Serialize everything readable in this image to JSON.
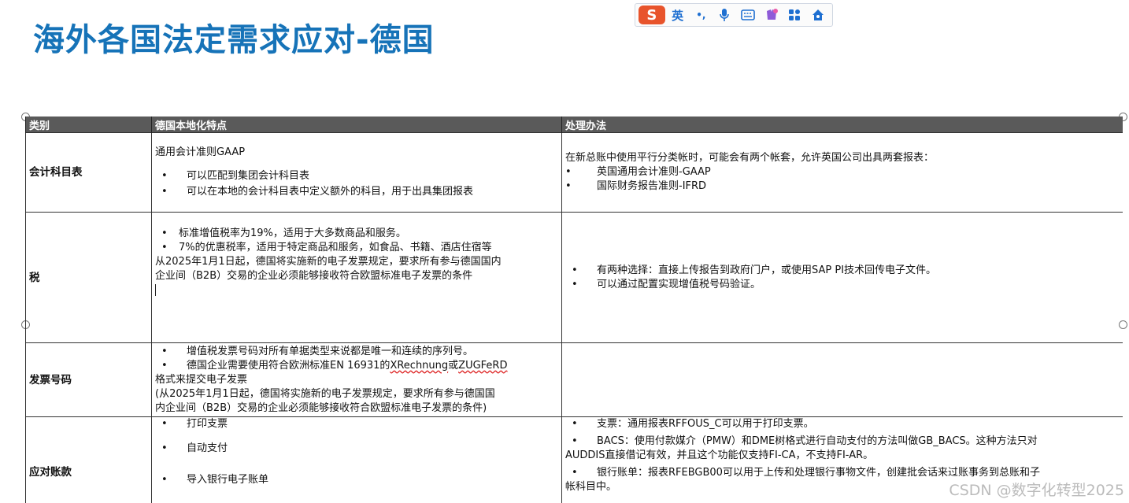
{
  "title": "海外各国法定需求应对-德国",
  "ime": {
    "logo": "S",
    "mode": "英",
    "punct": "•,"
  },
  "table": {
    "headers": [
      "类别",
      "德国本地化特点",
      "处理办法"
    ],
    "rows": {
      "coa": {
        "category": "会计科目表",
        "feature_intro": "通用会计准则GAAP",
        "feature_bullets": [
          "可以匹配到集团会计科目表",
          "可以在本地的会计科目表中定义额外的科目，用于出具集团报表"
        ],
        "handling_intro": "在新总账中使用平行分类帐时，可能会有两个帐套，允许英国公司出具两套报表：",
        "handling_bullets": [
          "英国通用会计准则-GAAP",
          "国际财务报告准则-IFRD"
        ]
      },
      "tax": {
        "category": "税",
        "feature_bullets": [
          "标准增值税率为19%，适用于大多数商品和服务。",
          "7%的优惠税率，适用于特定商品和服务，如食品、书籍、酒店住宿等"
        ],
        "feature_note_1": "从2025年1月1日起，德国将实施新的电子发票规定，要求所有参与德国国内",
        "feature_note_2": "企业间（B2B）交易的企业必须能够接收符合欧盟标准电子发票的条件",
        "handling_bullets": [
          "有两种选择：直接上传报告到政府门户，或使用SAP PI技术回传电子文件。",
          "可以通过配置实现增值税号码验证。"
        ]
      },
      "invoice": {
        "category": "发票号码",
        "feature_bullet_1": "增值税发票号码对所有单据类型来说都是唯一和连续的序列号。",
        "feature_bullet_2a": "德国企业需要使用符合欧洲标准EN 16931的",
        "feature_bullet_2b": "XRechnung",
        "feature_bullet_2c": "或",
        "feature_bullet_2d": "ZUGFeRD",
        "feature_bullet_2e": "格式来提交电子发票",
        "feature_note_1": "(从2025年1月1日起，德国将实施新的电子发票规定，要求所有参与德国国",
        "feature_note_2": "内企业间（B2B）交易的企业必须能够接收符合欧盟标准电子发票的条件)"
      },
      "payable": {
        "category": "应对账款",
        "feature_bullets": [
          "打印支票",
          "自动支付",
          "导入银行电子账单"
        ],
        "handling_1": "支票：通用报表RFFOUS_C可以用于打印支票。",
        "handling_2a": "BACS：使用付款媒介（PMW）和DME树格式进行自动支付的方法叫做GB_BACS。这种方法只对",
        "handling_2b": "AUDDIS直接借记有效，并且这个功能仅支持FI-CA，不支持FI-AR。",
        "handling_3a": "银行账单：报表RFEBGB00可以用于上传和处理银行事物文件，创建批会话来过账事务到总账和子",
        "handling_3b": "帐科目中。"
      }
    }
  },
  "bullet_glyph": "•",
  "watermark": "CSDN @数字化转型2025"
}
